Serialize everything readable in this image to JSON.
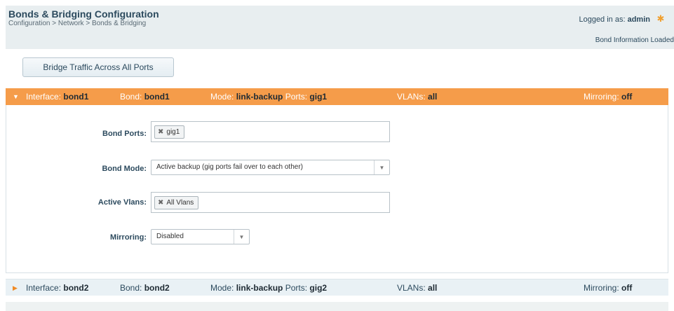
{
  "header": {
    "title": "Bonds & Bridging Configuration",
    "breadcrumb": "Configuration > Network > Bonds & Bridging",
    "logged_in_prefix": "Logged in as:",
    "username": "admin",
    "status": "Bond Information Loaded"
  },
  "actions": {
    "bridge_label": "Bridge Traffic Across All Ports"
  },
  "bonds": [
    {
      "interface_label": "Interface:",
      "interface": "bond1",
      "bond_label": "Bond:",
      "bond": "bond1",
      "mode_label": "Mode:",
      "mode": "link-backup",
      "ports_label": "Ports:",
      "ports": "gig1",
      "vlans_label": "VLANs:",
      "vlans": "all",
      "mirroring_label": "Mirroring:",
      "mirroring": "off",
      "expanded": true
    },
    {
      "interface_label": "Interface:",
      "interface": "bond2",
      "bond_label": "Bond:",
      "bond": "bond2",
      "mode_label": "Mode:",
      "mode": "link-backup",
      "ports_label": "Ports:",
      "ports": "gig2",
      "vlans_label": "VLANs:",
      "vlans": "all",
      "mirroring_label": "Mirroring:",
      "mirroring": "off",
      "expanded": false
    }
  ],
  "form": {
    "bond_ports_label": "Bond Ports:",
    "bond_ports_tag": "gig1",
    "bond_mode_label": "Bond Mode:",
    "bond_mode_value": "Active backup (gig ports fail over to each other)",
    "active_vlans_label": "Active Vlans:",
    "active_vlans_tag": "All Vlans",
    "mirroring_label": "Mirroring:",
    "mirroring_value": "Disabled"
  },
  "icons": {
    "expand": "triangle-down",
    "collapse": "triangle-right",
    "remove": "x",
    "settings": "gear"
  },
  "colors": {
    "accent": "#f59c4a",
    "header_bg": "#e8eef0",
    "title": "#2c4a5e"
  }
}
